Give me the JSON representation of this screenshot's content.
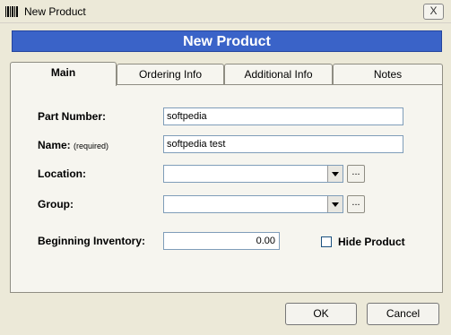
{
  "window": {
    "title": "New Product",
    "close_label": "X"
  },
  "banner": {
    "text": "New Product"
  },
  "tabs": [
    {
      "label": "Main",
      "active": true
    },
    {
      "label": "Ordering Info",
      "active": false
    },
    {
      "label": "Additional Info",
      "active": false
    },
    {
      "label": "Notes",
      "active": false
    }
  ],
  "form": {
    "part_number": {
      "label": "Part Number:",
      "value": "softpedia"
    },
    "name": {
      "label": "Name:",
      "required_note": "(required)",
      "value": "softpedia test"
    },
    "location": {
      "label": "Location:",
      "value": "",
      "browse_label": "..."
    },
    "group": {
      "label": "Group:",
      "value": "",
      "browse_label": "..."
    },
    "beginning_inventory": {
      "label": "Beginning Inventory:",
      "value": "0.00"
    },
    "hide_product": {
      "label": "Hide Product",
      "checked": false
    }
  },
  "buttons": {
    "ok": "OK",
    "cancel": "Cancel"
  },
  "icons": {
    "app": "barcode-icon",
    "close": "close-icon",
    "dropdown": "chevron-down-icon"
  },
  "colors": {
    "banner": "#3a63c8",
    "window_bg": "#ece9d8",
    "field_border": "#7f9db9"
  }
}
